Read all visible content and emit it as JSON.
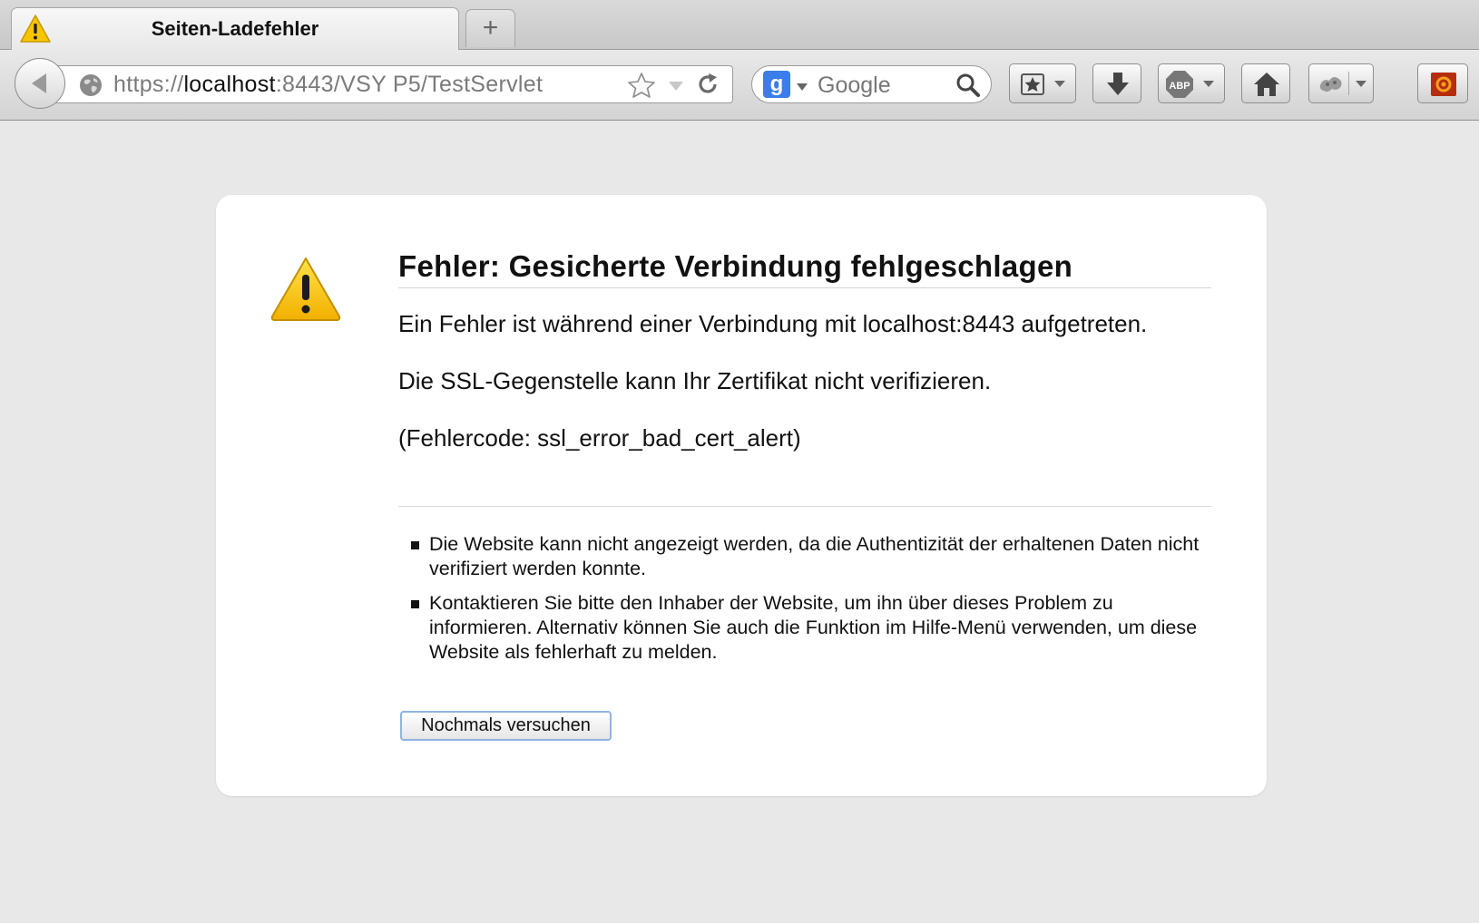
{
  "tab": {
    "title": "Seiten-Ladefehler",
    "icon": "warning-icon"
  },
  "new_tab_label": "+",
  "url": {
    "scheme": "https://",
    "host": "localhost",
    "rest": ":8443/VSY P5/TestServlet"
  },
  "search": {
    "engine_icon": "g",
    "placeholder": "Google"
  },
  "toolbar_icons": [
    "bookmarks-icon",
    "download-icon",
    "adblock-icon",
    "home-icon",
    "addon-icon",
    "extension-icon"
  ],
  "abp_label": "ABP",
  "error": {
    "title": "Fehler: Gesicherte Verbindung fehlgeschlagen",
    "line1": "Ein Fehler ist während einer Verbindung mit localhost:8443 aufgetreten.",
    "line2": "Die SSL-Gegenstelle kann Ihr Zertifikat nicht verifizieren.",
    "code": "(Fehlercode: ssl_error_bad_cert_alert)",
    "bullets": [
      "Die Website kann nicht angezeigt werden, da die Authentizität der erhaltenen Daten nicht verifiziert werden konnte.",
      "Kontaktieren Sie bitte den Inhaber der Website, um ihn über dieses Problem zu informieren. Alternativ können Sie auch die Funktion im Hilfe-Menü verwenden, um diese Website als fehlerhaft zu melden."
    ],
    "retry_label": "Nochmals versuchen"
  },
  "colors": {
    "warning_yellow": "#f6c400",
    "page_bg": "#e8e8e8",
    "search_blue": "#3b7de9"
  }
}
